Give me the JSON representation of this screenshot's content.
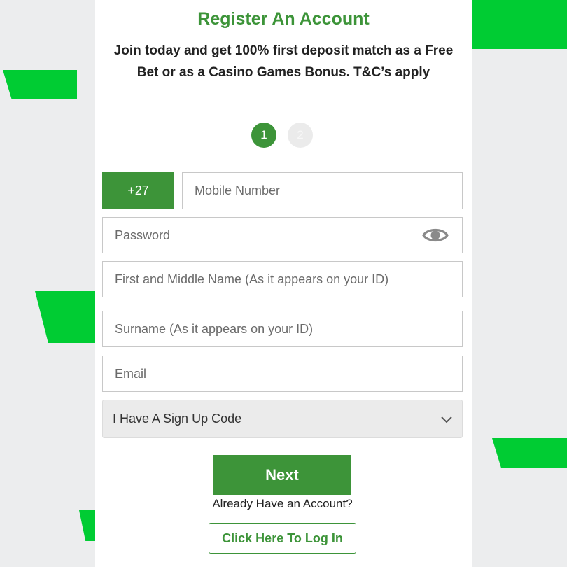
{
  "brand": {
    "accent": "#3d9439",
    "decor_green": "#00cc33",
    "background": "#ecedee"
  },
  "form": {
    "title": "Register An Account",
    "subtitle": "Join today and get 100% first deposit match as a Free Bet or as a Casino Games Bonus. T&C’s apply",
    "steps": [
      "1",
      "2"
    ],
    "active_step": "1",
    "country_code": "+27",
    "mobile_placeholder": "Mobile Number",
    "password_placeholder": "Password",
    "password_toggle_icon": "eye-icon",
    "first_name_placeholder": "First and Middle Name (As it appears on your ID)",
    "surname_placeholder": "Surname (As it appears on your ID)",
    "email_placeholder": "Email",
    "signup_code_select": "I Have A Sign Up Code",
    "select_icon": "chevron-down-icon",
    "next_label": "Next",
    "already_text": "Already Have an Account?",
    "login_label": "Click Here To Log In"
  }
}
